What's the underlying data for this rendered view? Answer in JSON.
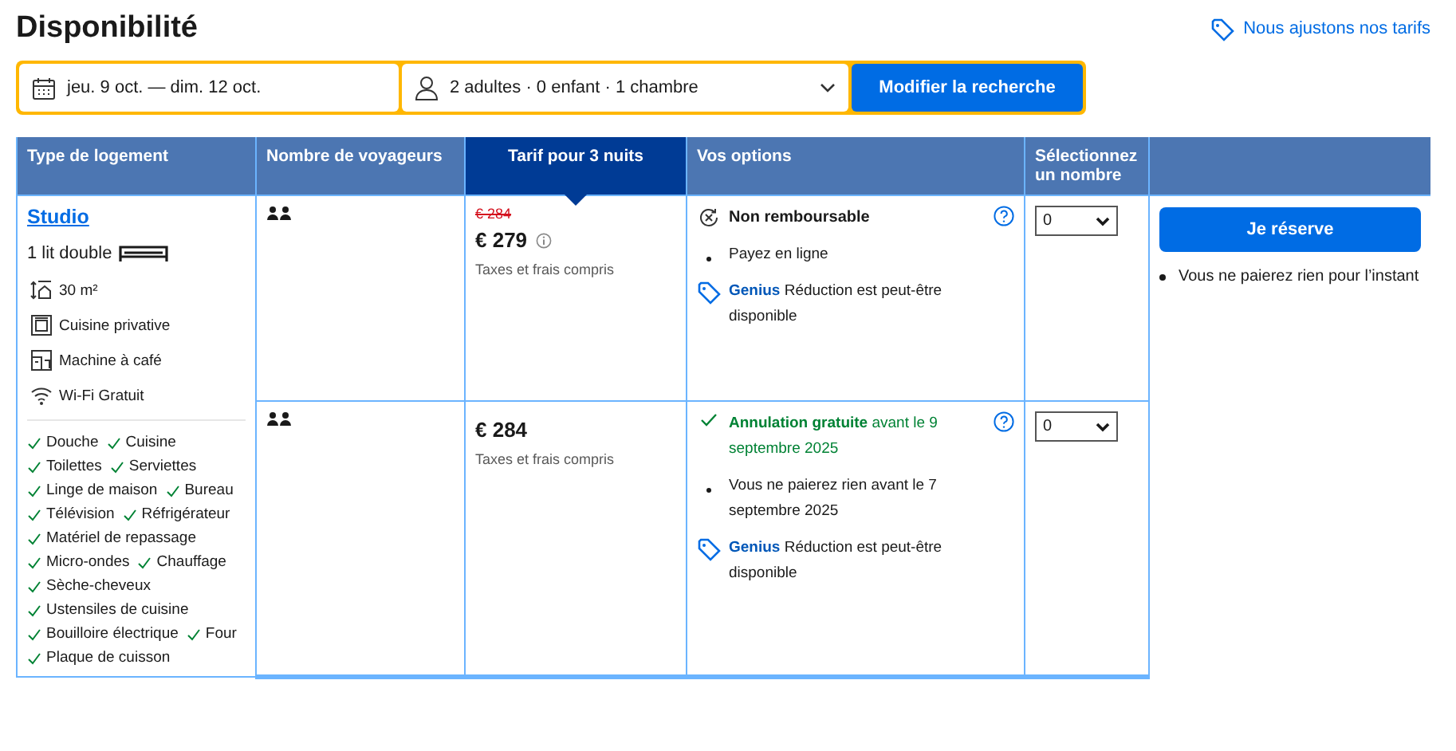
{
  "title": "Disponibilité",
  "price_link": "Nous ajustons nos tarifs",
  "search": {
    "checkin": "jeu. 9 oct.",
    "separator": "—",
    "checkout": "dim. 12 oct.",
    "guests": "2 adultes · 0 enfant · 1 chambre",
    "button": "Modifier la recherche"
  },
  "table": {
    "columns": [
      {
        "label": "Type de logement",
        "selected": false
      },
      {
        "label": "Nombre de voyageurs",
        "selected": false
      },
      {
        "label": "Tarif pour 3 nuits",
        "selected": true
      },
      {
        "label": "Vos options",
        "selected": false
      },
      {
        "label": "Sélectionnez un nombre",
        "selected": false
      }
    ],
    "room": {
      "name": "Studio",
      "bed": "1 lit double",
      "facilities": [
        {
          "kind": "size",
          "text": "30 m²"
        },
        {
          "kind": "kitchen",
          "text": "Cuisine privative"
        },
        {
          "kind": "coffee",
          "text": "Machine à café"
        },
        {
          "kind": "wifi",
          "text": "Wi-Fi Gratuit"
        }
      ],
      "amenities": [
        "Douche",
        "Cuisine",
        "Toilettes",
        "Serviettes",
        "Linge de maison",
        "Bureau",
        "Télévision",
        "Réfrigérateur",
        "Matériel de repassage",
        "Micro-ondes",
        "Chauffage",
        "Sèche-cheveux",
        "Ustensiles de cuisine",
        "Bouilloire électrique",
        "Four",
        "Plaque de cuisson"
      ]
    },
    "offers": [
      {
        "old_price": "€ 284",
        "price": "€ 279",
        "price_info": true,
        "taxes": "Taxes et frais compris",
        "options": [
          {
            "kind": "non_refundable",
            "text": "Non remboursable"
          },
          {
            "kind": "bullet",
            "text": "Payez en ligne"
          },
          {
            "kind": "genius",
            "text": "**Genius** Réduction est peut-être disponible"
          }
        ],
        "quantity": "0"
      },
      {
        "price": "€ 284",
        "price_info": false,
        "taxes": "Taxes et frais compris",
        "options": [
          {
            "kind": "free_cancel",
            "text": "**Annulation gratuite** avant le 9 septembre 2025"
          },
          {
            "kind": "bullet",
            "text": "Vous ne paierez rien avant le 7 septembre 2025"
          },
          {
            "kind": "genius",
            "text": "**Genius** Réduction est peut-être disponible"
          }
        ],
        "quantity": "0"
      }
    ],
    "reserve": {
      "button": "Je réserve",
      "note": "Vous ne paierez rien pour l’instant"
    }
  }
}
